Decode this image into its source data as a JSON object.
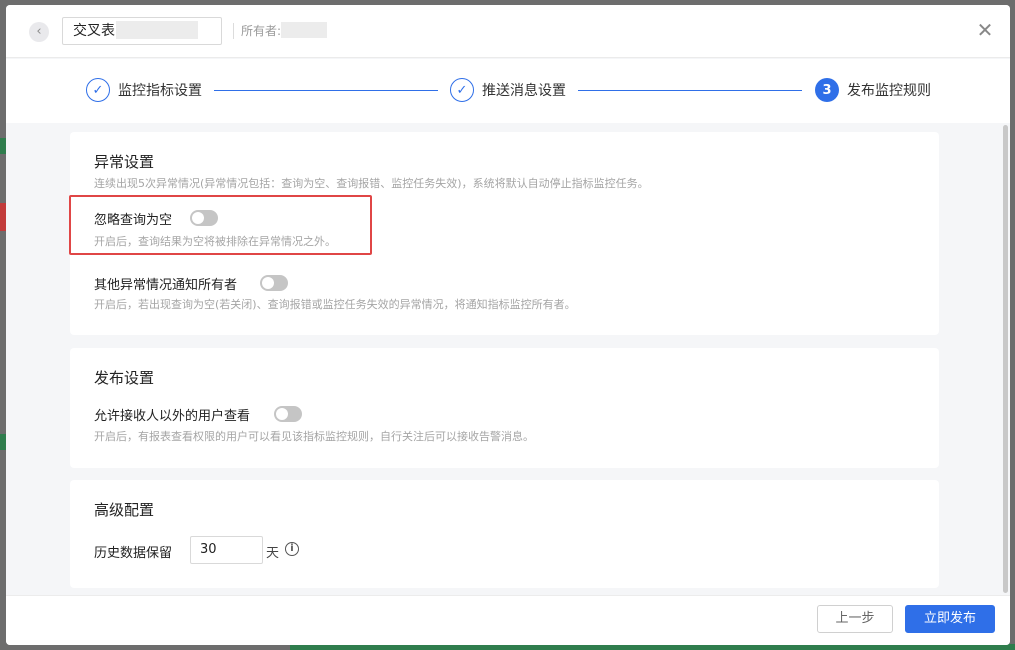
{
  "header": {
    "back_icon": "chevron-left-icon",
    "report_name": "交叉表",
    "owner_label": "所有者:",
    "close_icon": "close-icon"
  },
  "steps": [
    {
      "label": "监控指标设置",
      "status": "done",
      "mark": "✓"
    },
    {
      "label": "推送消息设置",
      "status": "done",
      "mark": "✓"
    },
    {
      "label": "发布监控规则",
      "status": "active",
      "mark": "3"
    }
  ],
  "anomaly": {
    "title": "异常设置",
    "desc": "连续出现5次异常情况(异常情况包括：查询为空、查询报错、监控任务失效)，系统将默认自动停止指标监控任务。",
    "ignore_empty": {
      "label": "忽略查询为空",
      "desc": "开启后，查询结果为空将被排除在异常情况之外。",
      "enabled": false
    },
    "notify_owner": {
      "label": "其他异常情况通知所有者",
      "desc": "开启后，若出现查询为空(若关闭)、查询报错或监控任务失效的异常情况，将通知指标监控所有者。",
      "enabled": false
    }
  },
  "publish": {
    "title": "发布设置",
    "allow_others": {
      "label": "允许接收人以外的用户查看",
      "desc": "开启后，有报表查看权限的用户可以看见该指标监控规则，自行关注后可以接收告警消息。",
      "enabled": false
    }
  },
  "advanced": {
    "title": "高级配置",
    "history_label": "历史数据保留",
    "history_value": "30",
    "history_unit": "天",
    "info_glyph": "i"
  },
  "footer": {
    "prev_label": "上一步",
    "publish_label": "立即发布"
  },
  "colors": {
    "primary": "#2f6fe8",
    "highlight": "#e04646"
  }
}
